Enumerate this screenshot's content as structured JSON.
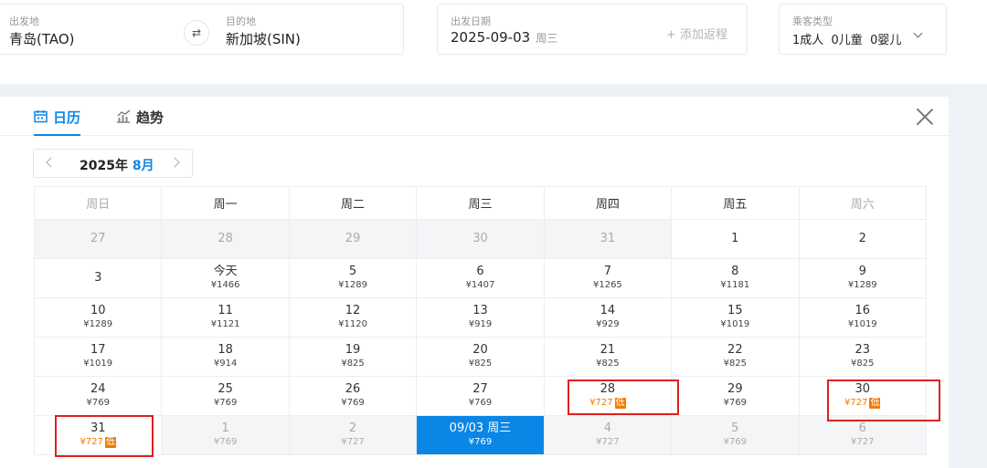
{
  "search": {
    "origin_label": "出发地",
    "origin_value": "青岛(TAO)",
    "swap_icon": "swap-icon",
    "dest_label": "目的地",
    "dest_value": "新加坡(SIN)",
    "depart_label": "出发日期",
    "depart_date": "2025-09-03",
    "depart_weekday": "周三",
    "add_return": "+ 添加返程",
    "passenger_label": "乘客类型",
    "passenger_value": "1成人  0儿童  0婴儿"
  },
  "tabs": {
    "calendar": "日历",
    "trend": "趋势"
  },
  "month_nav": {
    "year": "2025年",
    "month": "8月"
  },
  "colors": {
    "accent": "#0a86e6",
    "low_price": "#f27b00",
    "highlight_box": "#e02020"
  },
  "weekdays": [
    "周日",
    "周一",
    "周二",
    "周三",
    "周四",
    "周五",
    "周六"
  ],
  "calendar_rows": [
    [
      {
        "day": "27",
        "price": "",
        "state": "other"
      },
      {
        "day": "28",
        "price": "",
        "state": "other"
      },
      {
        "day": "29",
        "price": "",
        "state": "other"
      },
      {
        "day": "30",
        "price": "",
        "state": "other"
      },
      {
        "day": "31",
        "price": "",
        "state": "other"
      },
      {
        "day": "1",
        "price": "",
        "state": "normal"
      },
      {
        "day": "2",
        "price": "",
        "state": "normal"
      }
    ],
    [
      {
        "day": "3",
        "price": "",
        "state": "normal"
      },
      {
        "day": "今天",
        "price": "¥1466",
        "state": "normal"
      },
      {
        "day": "5",
        "price": "¥1289",
        "state": "normal"
      },
      {
        "day": "6",
        "price": "¥1407",
        "state": "normal"
      },
      {
        "day": "7",
        "price": "¥1265",
        "state": "normal"
      },
      {
        "day": "8",
        "price": "¥1181",
        "state": "normal"
      },
      {
        "day": "9",
        "price": "¥1289",
        "state": "normal"
      }
    ],
    [
      {
        "day": "10",
        "price": "¥1289",
        "state": "normal"
      },
      {
        "day": "11",
        "price": "¥1121",
        "state": "normal"
      },
      {
        "day": "12",
        "price": "¥1120",
        "state": "normal"
      },
      {
        "day": "13",
        "price": "¥919",
        "state": "normal"
      },
      {
        "day": "14",
        "price": "¥929",
        "state": "normal"
      },
      {
        "day": "15",
        "price": "¥1019",
        "state": "normal"
      },
      {
        "day": "16",
        "price": "¥1019",
        "state": "normal"
      }
    ],
    [
      {
        "day": "17",
        "price": "¥1019",
        "state": "normal"
      },
      {
        "day": "18",
        "price": "¥914",
        "state": "normal"
      },
      {
        "day": "19",
        "price": "¥825",
        "state": "normal"
      },
      {
        "day": "20",
        "price": "¥825",
        "state": "normal"
      },
      {
        "day": "21",
        "price": "¥825",
        "state": "normal"
      },
      {
        "day": "22",
        "price": "¥825",
        "state": "normal"
      },
      {
        "day": "23",
        "price": "¥825",
        "state": "normal"
      }
    ],
    [
      {
        "day": "24",
        "price": "¥769",
        "state": "normal"
      },
      {
        "day": "25",
        "price": "¥769",
        "state": "normal"
      },
      {
        "day": "26",
        "price": "¥769",
        "state": "normal"
      },
      {
        "day": "27",
        "price": "¥769",
        "state": "normal"
      },
      {
        "day": "28",
        "price": "¥727",
        "state": "normal",
        "low": "低"
      },
      {
        "day": "29",
        "price": "¥769",
        "state": "normal"
      },
      {
        "day": "30",
        "price": "¥727",
        "state": "normal",
        "low": "低"
      }
    ],
    [
      {
        "day": "31",
        "price": "¥727",
        "state": "normal",
        "low": "低"
      },
      {
        "day": "1",
        "price": "¥769",
        "state": "other"
      },
      {
        "day": "2",
        "price": "¥727",
        "state": "other"
      },
      {
        "day": "09/03 周三",
        "price": "¥769",
        "state": "selected"
      },
      {
        "day": "4",
        "price": "¥727",
        "state": "other"
      },
      {
        "day": "5",
        "price": "¥769",
        "state": "other"
      },
      {
        "day": "6",
        "price": "¥727",
        "state": "other"
      }
    ]
  ]
}
